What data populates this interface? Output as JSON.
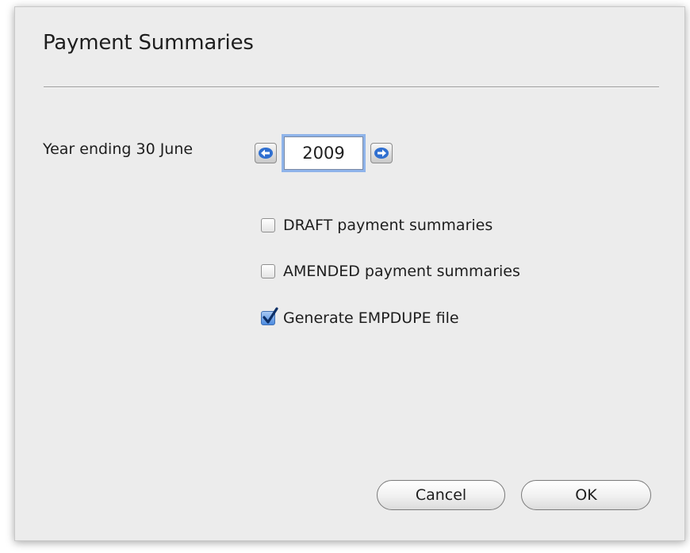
{
  "dialog": {
    "title": "Payment Summaries",
    "year_label": "Year ending 30 June",
    "year_value": "2009",
    "options": [
      {
        "label": "DRAFT payment summaries",
        "checked": false
      },
      {
        "label": "AMENDED payment summaries",
        "checked": false
      },
      {
        "label": "Generate EMPDUPE file",
        "checked": true
      }
    ],
    "cancel_label": "Cancel",
    "ok_label": "OK"
  },
  "colors": {
    "dialog_background": "#ececec",
    "focus_ring": "#8fb4ea",
    "checkbox_checked": "#4c8be0",
    "arrow_icon": "#2f6fd0"
  },
  "icons": {
    "decrement": "left-arrow-icon",
    "increment": "right-arrow-icon",
    "check": "checkmark-icon"
  }
}
